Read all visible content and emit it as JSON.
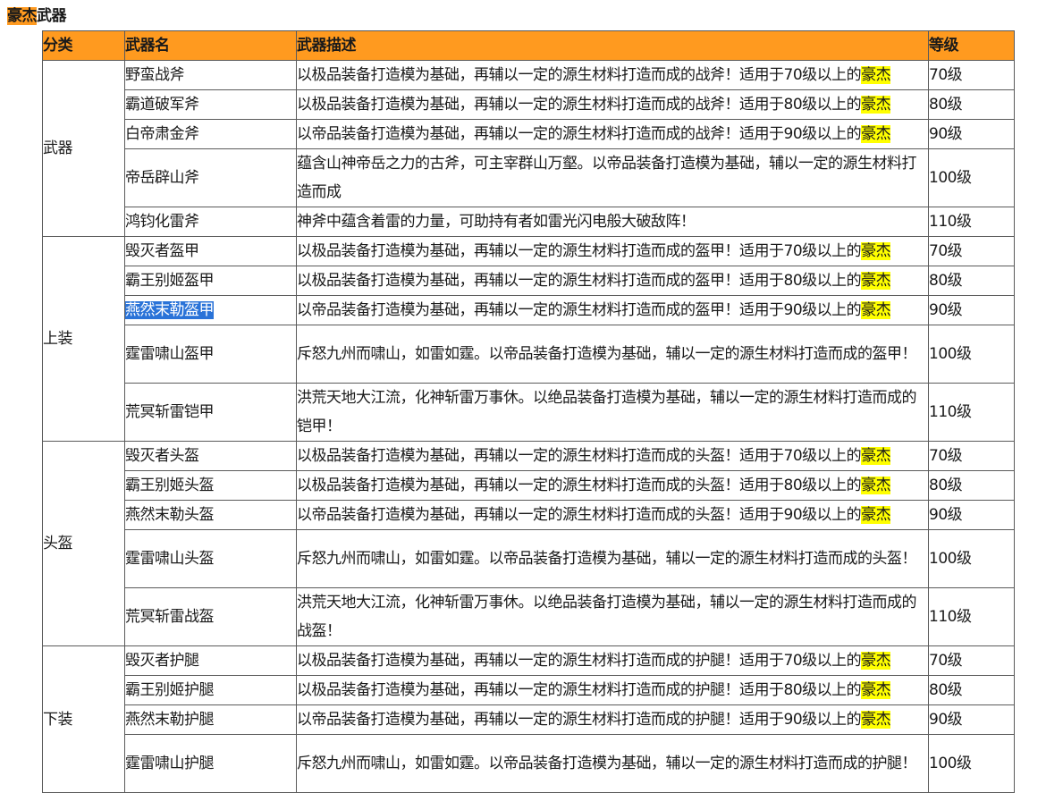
{
  "title": {
    "highlight": "豪杰",
    "rest": "武器"
  },
  "headers": {
    "category": "分类",
    "name": "武器名",
    "desc": "武器描述",
    "level": "等级"
  },
  "colors": {
    "header_bg": "#ff9a1f",
    "highlight": "#ffff00",
    "selection": "#2a73d8"
  },
  "groups": [
    {
      "category": "武器",
      "items": [
        {
          "name": "野蛮战斧",
          "desc": "以极品装备打造模为基础，再辅以一定的源生材料打造而成的战斧！适用于70级以上的",
          "hl": "豪杰",
          "level": "70级"
        },
        {
          "name": "霸道破军斧",
          "desc": "以极品装备打造模为基础，再辅以一定的源生材料打造而成的战斧！适用于80级以上的",
          "hl": "豪杰",
          "level": "80级"
        },
        {
          "name": "白帝肃金斧",
          "desc": "以帝品装备打造模为基础，再辅以一定的源生材料打造而成的战斧！适用于90级以上的",
          "hl": "豪杰",
          "level": "90级"
        },
        {
          "name": "帝岳辟山斧",
          "desc": "蕴含山神帝岳之力的古斧，可主宰群山万壑。以帝品装备打造模为基础，辅以一定的源生材料打造而成",
          "level": "100级",
          "tall": true
        },
        {
          "name": "鸿钧化雷斧",
          "desc": "神斧中蕴含着雷的力量，可助持有者如雷光闪电般大破敌阵！",
          "level": "110级"
        }
      ]
    },
    {
      "category": "上装",
      "items": [
        {
          "name": "毁灭者盔甲",
          "desc": "以极品装备打造模为基础，再辅以一定的源生材料打造而成的盔甲！适用于70级以上的",
          "hl": "豪杰",
          "level": "70级"
        },
        {
          "name": "霸王别姬盔甲",
          "desc": "以极品装备打造模为基础，再辅以一定的源生材料打造而成的盔甲！适用于80级以上的",
          "hl": "豪杰",
          "level": "80级"
        },
        {
          "name": "燕然末勒盔甲",
          "desc": "以帝品装备打造模为基础，再辅以一定的源生材料打造而成的盔甲！适用于90级以上的",
          "hl": "豪杰",
          "level": "90级",
          "selected": true
        },
        {
          "name": "霆雷啸山盔甲",
          "desc": "斥怒九州而啸山，如雷如霆。以帝品装备打造模为基础，辅以一定的源生材料打造而成的盔甲！",
          "level": "100级",
          "tall": true
        },
        {
          "name": "荒冥斩雷铠甲",
          "desc": "洪荒天地大江流，化神斩雷万事休。以绝品装备打造模为基础，辅以一定的源生材料打造而成的铠甲！",
          "level": "110级",
          "tall": true
        }
      ]
    },
    {
      "category": "头盔",
      "items": [
        {
          "name": "毁灭者头盔",
          "desc": "以极品装备打造模为基础，再辅以一定的源生材料打造而成的头盔！适用于70级以上的",
          "hl": "豪杰",
          "level": "70级"
        },
        {
          "name": "霸王别姬头盔",
          "desc": "以极品装备打造模为基础，再辅以一定的源生材料打造而成的头盔！适用于80级以上的",
          "hl": "豪杰",
          "level": "80级"
        },
        {
          "name": "燕然末勒头盔",
          "desc": "以帝品装备打造模为基础，再辅以一定的源生材料打造而成的头盔！适用于90级以上的",
          "hl": "豪杰",
          "level": "90级"
        },
        {
          "name": "霆雷啸山头盔",
          "desc": "斥怒九州而啸山，如雷如霆。以帝品装备打造模为基础，辅以一定的源生材料打造而成的头盔！",
          "level": "100级",
          "tall": true
        },
        {
          "name": "荒冥斩雷战盔",
          "desc": "洪荒天地大江流，化神斩雷万事休。以绝品装备打造模为基础，辅以一定的源生材料打造而成的战盔！",
          "level": "110级",
          "tall": true
        }
      ]
    },
    {
      "category": "下装",
      "items": [
        {
          "name": "毁灭者护腿",
          "desc": "以极品装备打造模为基础，再辅以一定的源生材料打造而成的护腿！适用于70级以上的",
          "hl": "豪杰",
          "level": "70级"
        },
        {
          "name": "霸王别姬护腿",
          "desc": "以极品装备打造模为基础，再辅以一定的源生材料打造而成的护腿！适用于80级以上的",
          "hl": "豪杰",
          "level": "80级"
        },
        {
          "name": "燕然末勒护腿",
          "desc": "以帝品装备打造模为基础，再辅以一定的源生材料打造而成的护腿！适用于90级以上的",
          "hl": "豪杰",
          "level": "90级"
        },
        {
          "name": "霆雷啸山护腿",
          "desc": "斥怒九州而啸山，如雷如霆。以帝品装备打造模为基础，辅以一定的源生材料打造而成的护腿！",
          "level": "100级",
          "tall": true
        }
      ]
    }
  ]
}
